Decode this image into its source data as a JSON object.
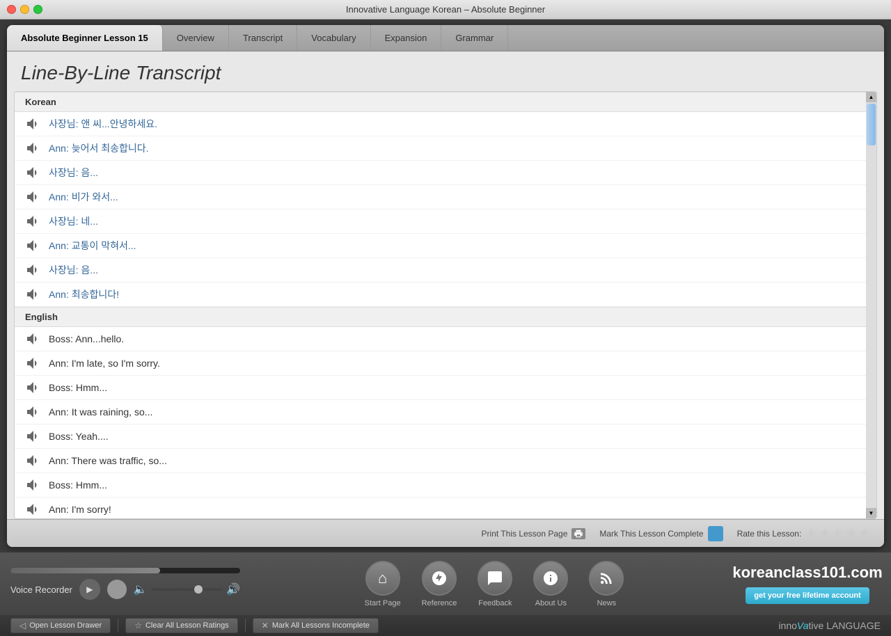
{
  "window": {
    "title": "Innovative Language Korean – Absolute Beginner"
  },
  "tabs": [
    {
      "id": "lesson",
      "label": "Absolute Beginner Lesson 15",
      "active": true
    },
    {
      "id": "overview",
      "label": "Overview",
      "active": false
    },
    {
      "id": "transcript",
      "label": "Transcript",
      "active": false
    },
    {
      "id": "vocabulary",
      "label": "Vocabulary",
      "active": false
    },
    {
      "id": "expansion",
      "label": "Expansion",
      "active": false
    },
    {
      "id": "grammar",
      "label": "Grammar",
      "active": false
    }
  ],
  "page_title": "Line-By-Line Transcript",
  "transcript": {
    "korean_header": "Korean",
    "english_header": "English",
    "korean_lines": [
      "사장님: 앤 씨...안녕하세요.",
      "Ann: 늦어서 최송합니다.",
      "사장님: 음...",
      "Ann: 비가 와서...",
      "사장님: 네...",
      "Ann: 교통이 막혀서...",
      "사장님: 음...",
      "Ann: 최송합니다!"
    ],
    "english_lines": [
      "Boss: Ann...hello.",
      "Ann: I'm late, so I'm sorry.",
      "Boss: Hmm...",
      "Ann: It was raining, so...",
      "Boss: Yeah....",
      "Ann: There was traffic, so...",
      "Boss: Hmm...",
      "Ann: I'm sorry!"
    ]
  },
  "bottom_bar": {
    "print_label": "Print This Lesson Page",
    "complete_label": "Mark This Lesson Complete",
    "rate_label": "Rate this Lesson:"
  },
  "footer": {
    "recorder_label": "Voice Recorder",
    "nav_items": [
      {
        "id": "start-page",
        "label": "Start Page",
        "icon": "⌂"
      },
      {
        "id": "reference",
        "label": "Reference",
        "icon": "◎"
      },
      {
        "id": "feedback",
        "label": "Feedback",
        "icon": "💬"
      },
      {
        "id": "about-us",
        "label": "About Us",
        "icon": "ℹ"
      },
      {
        "id": "news",
        "label": "News",
        "icon": "📡"
      }
    ],
    "brand": {
      "name_inno": "inno",
      "name_vative": "Va",
      "name_rest": "tive",
      "sub": "LANGUAGE",
      "domain": "koreanclass101.com",
      "cta": "get your free lifetime account"
    }
  },
  "toolbar": {
    "open_drawer": "Open Lesson Drawer",
    "clear_ratings": "Clear All Lesson Ratings",
    "mark_incomplete": "Mark All Lessons Incomplete",
    "brand_inno": "inno",
    "brand_va": "Va",
    "brand_rest": "tive LANGUAGE"
  }
}
